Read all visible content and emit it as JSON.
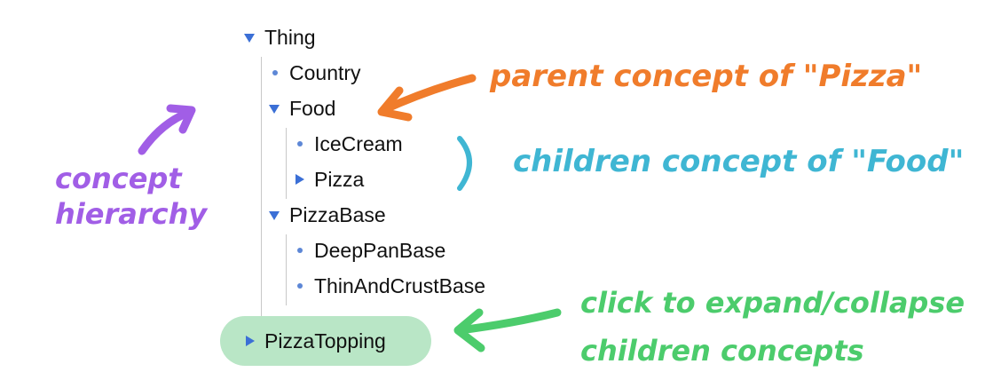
{
  "tree": {
    "root": {
      "label": "Thing",
      "state": "expanded"
    },
    "items": [
      {
        "label": "Country",
        "state": "leaf"
      },
      {
        "label": "Food",
        "state": "expanded"
      },
      {
        "label": "IceCream",
        "state": "leaf"
      },
      {
        "label": "Pizza",
        "state": "collapsed"
      },
      {
        "label": "PizzaBase",
        "state": "expanded"
      },
      {
        "label": "DeepPanBase",
        "state": "leaf"
      },
      {
        "label": "ThinAndCrustBase",
        "state": "leaf"
      },
      {
        "label": "PizzaTopping",
        "state": "collapsed"
      }
    ]
  },
  "annotations": {
    "hierarchy": {
      "line1": "concept",
      "line2": "hierarchy",
      "color": "#a15ee6"
    },
    "parent": {
      "text": "parent concept of \"Pizza\"",
      "color": "#f07c2b"
    },
    "children": {
      "text": "children concept of \"Food\"",
      "color": "#3fb6d3"
    },
    "expand": {
      "line1": "click to expand/collapse",
      "line2": "children concepts",
      "color": "#4ccc6c"
    }
  },
  "colors": {
    "arrow_marker": "#3b6fd6",
    "highlight": "#b9e6c6",
    "tree_text": "#111111"
  }
}
